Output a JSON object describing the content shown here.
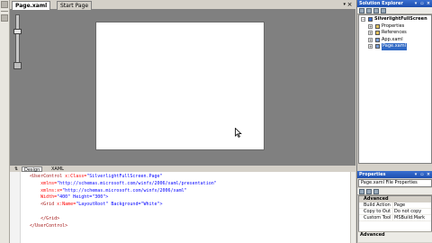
{
  "document": {
    "tabs": [
      {
        "label": "Page.xaml",
        "active": true
      },
      {
        "label": "Start Page",
        "active": false
      }
    ],
    "close_glyph": "×",
    "dropdown_glyph": "▾"
  },
  "view_tabs": [
    {
      "label": "Design"
    },
    {
      "label": "XAML"
    },
    {
      "label": ""
    }
  ],
  "xaml": {
    "lines": [
      {
        "pre": "  ",
        "tag": "<UserControl",
        "attr": " x:Class=",
        "val": "\"SilverlightFullScreen.Page\""
      },
      {
        "pre": "      ",
        "tag": "",
        "attr": "xmlns=",
        "val": "\"http://schemas.microsoft.com/winfx/2006/xaml/presentation\""
      },
      {
        "pre": "      ",
        "tag": "",
        "attr": "xmlns:x=",
        "val": "\"http://schemas.microsoft.com/winfx/2006/xaml\""
      },
      {
        "pre": "      ",
        "tag": "",
        "attr": "Width=",
        "val": "\"400\" Height=\"300\">"
      },
      {
        "pre": "      ",
        "tag": "<Grid",
        "attr": " x:Name=",
        "val": "\"LayoutRoot\" Background=\"White\">"
      },
      {
        "pre": "",
        "tag": "",
        "attr": "",
        "val": ""
      },
      {
        "pre": "      ",
        "tag": "</Grid>",
        "attr": "",
        "val": ""
      },
      {
        "pre": "  ",
        "tag": "</UserControl>",
        "attr": "",
        "val": ""
      }
    ]
  },
  "solution_explorer": {
    "title": "Solution Explorer",
    "tree": [
      {
        "label": "SilverlightFullScreen",
        "indent": 0,
        "expander": "−",
        "icon": "project-icon",
        "bold": true,
        "selected": false
      },
      {
        "label": "Properties",
        "indent": 1,
        "expander": "+",
        "icon": "properties-folder-icon",
        "bold": false,
        "selected": false
      },
      {
        "label": "References",
        "indent": 1,
        "expander": "+",
        "icon": "references-folder-icon",
        "bold": false,
        "selected": false
      },
      {
        "label": "App.xaml",
        "indent": 1,
        "expander": "+",
        "icon": "xaml-file-icon",
        "bold": false,
        "selected": false
      },
      {
        "label": "Page.xaml",
        "indent": 1,
        "expander": "+",
        "icon": "xaml-file-icon",
        "bold": false,
        "selected": true
      }
    ]
  },
  "properties": {
    "title": "Properties",
    "object": "Page.xaml File Properties",
    "category": "Advanced",
    "rows": [
      {
        "name": "Build Action",
        "value": "Page"
      },
      {
        "name": "Copy to Outp",
        "value": "Do not copy"
      },
      {
        "name": "Custom Tool",
        "value": "MSBuild:Mark"
      }
    ],
    "description": "Advanced"
  },
  "colors": {
    "canvas": "#ffffff",
    "document_background": "#808080",
    "selection": "#316ac5",
    "titlebar": "#1c4fb0"
  }
}
